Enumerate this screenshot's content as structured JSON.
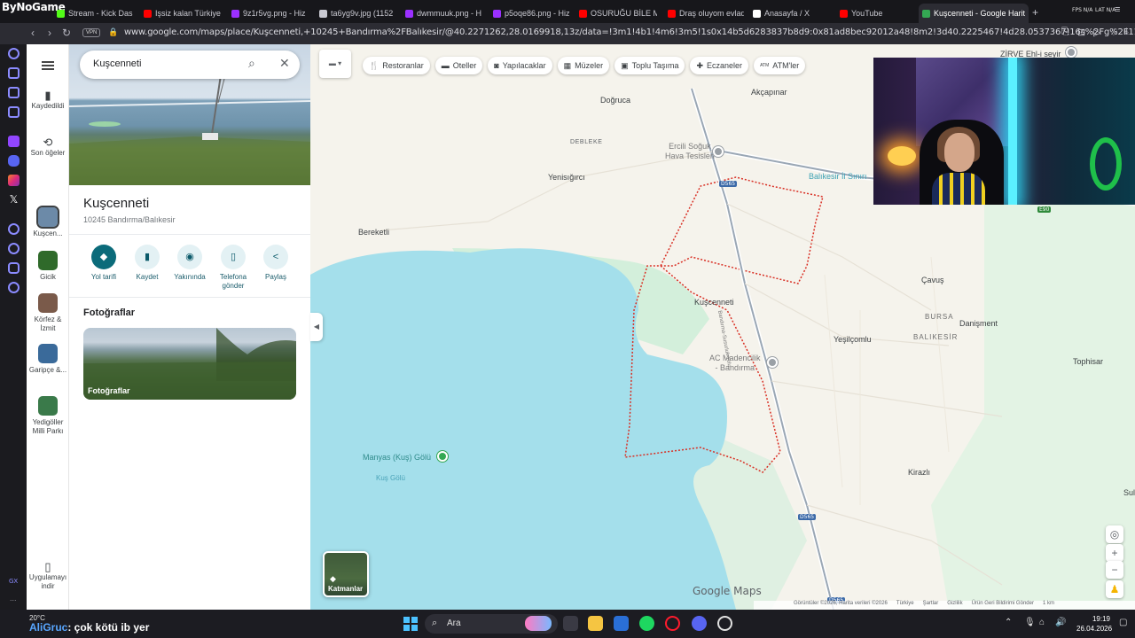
{
  "browser": {
    "logo": "ByNoGame",
    "tabs": [
      {
        "label": "Stream - Kick Das",
        "color": "#53fc18"
      },
      {
        "label": "Işsiz kalan Türkiye",
        "color": "#ff0000"
      },
      {
        "label": "9z1r5vg.png - Hiz",
        "color": "#9b30ff"
      },
      {
        "label": "ta6yg9v.jpg (1152",
        "color": "#c9c9d1"
      },
      {
        "label": "dwmmuuk.png - H",
        "color": "#9b30ff"
      },
      {
        "label": "p5oqe86.png - Hiz",
        "color": "#9b30ff"
      },
      {
        "label": "OSURUĞU BİLE M",
        "color": "#ff0000"
      },
      {
        "label": "Draş oluyom evlad",
        "color": "#ff0000"
      },
      {
        "label": "Anasayfa / X",
        "color": "#ffffff"
      },
      {
        "label": "YouTube",
        "color": "#ff0000"
      },
      {
        "label": "Kuşcenneti - Google Harit",
        "color": "#34a853"
      }
    ],
    "new_tab": "+",
    "fps": "FPS N/A",
    "lat": "LAT N/A",
    "vpn": "VPN",
    "url": "www.google.com/maps/place/Kuşcenneti,+10245+Bandırma%2FBalıkesir/@40.2271262,28.0169918,13z/data=!3m1!4b1!4m6!3m5!1s0x14b5d6283837b8d9:0x81ad8bec92012a48!8m2!3d40.2225467!4d28.0537367!16s%2Fg%2F113drxp67"
  },
  "opera_sidebar": {
    "gx": "GX",
    "more": "...",
    "icons": [
      "aria-icon",
      "maps-icon",
      "x-icon",
      "twitch-icon",
      "discord-icon",
      "instagram-icon",
      "settings-icon"
    ]
  },
  "rail": {
    "saved": "Kaydedildi",
    "recent": "Son öğeler",
    "recents": [
      {
        "label": "Kuşcen...",
        "color": "#6c8aa8"
      },
      {
        "label": "Gicik",
        "color": "#2f6a2a"
      },
      {
        "label": "Körfez & İzmit",
        "color": "#7a5a4a"
      },
      {
        "label": "Garipçe &...",
        "color": "#3a6a9a"
      },
      {
        "label": "Yedigöller Milli Parkı",
        "color": "#3a7a4a"
      }
    ],
    "get_app": "Uygulamayı indir"
  },
  "panel": {
    "search_value": "Kuşcenneti",
    "place_title": "Kuşcenneti",
    "place_address": "10245 Bandırma/Balıkesir",
    "actions": [
      {
        "label": "Yol tarifi",
        "glyph": "◆"
      },
      {
        "label": "Kaydet",
        "glyph": "▮"
      },
      {
        "label": "Yakınında",
        "glyph": "◉"
      },
      {
        "label": "Telefona gönder",
        "glyph": "▯"
      },
      {
        "label": "Paylaş",
        "glyph": "<"
      }
    ],
    "photos_title": "Fotoğraflar",
    "photos_label": "Fotoğraflar"
  },
  "map": {
    "chips": [
      {
        "label": "Restoranlar",
        "glyph": "🍴"
      },
      {
        "label": "Oteller",
        "glyph": "▬"
      },
      {
        "label": "Yapılacaklar",
        "glyph": "◙"
      },
      {
        "label": "Müzeler",
        "glyph": "▦"
      },
      {
        "label": "Toplu Taşıma",
        "glyph": "▣"
      },
      {
        "label": "Eczaneler",
        "glyph": "✚"
      },
      {
        "label": "ATM'ler",
        "glyph": "ATM"
      }
    ],
    "labels": {
      "zirve": "ZİRVE Ehl-i seyir",
      "akcapinar": "Akçapınar",
      "dogruca": "Doğruca",
      "debleke": "DEBLEKE",
      "ercili": "Ercili Soğuk\nHava Tesisleri",
      "yenisigirci": "Yenisığırcı",
      "balikesir_siniri": "Balıkesir İl Sınırı",
      "bereketli": "Bereketli",
      "cavus": "Çavuş",
      "kuscenneti": "Kuşcenneti",
      "bursa": "BURSA",
      "balikesir": "BALIKESİR",
      "danisment": "Danişment",
      "yesilcomlu": "Yeşilçomlu",
      "ac_madencilik": "AC Madencilik\n- Bandırma",
      "tophisar": "Tophisar",
      "manyas": "Manyas (Kuş) Gölü",
      "kus_golu": "Kuş Gölü",
      "kirazli": "Kirazlı",
      "sul": "Sul",
      "road": "Bandırma-Susurluk Yolu"
    },
    "shields": [
      "D565",
      "E90",
      "D565",
      "D565"
    ],
    "layers_label": "Katmanlar",
    "brand": "Google Maps",
    "footer": [
      "Görüntüler ©2026, Harita verileri ©2026",
      "Türkiye",
      "Şartlar",
      "Gizlilik",
      "Ürün Geri Bildirimi Gönder",
      "1 km"
    ],
    "colors": {
      "water": "#a4dfeb",
      "land": "#f5f3ec",
      "green": "#d3efdb",
      "boundary": "#d93025",
      "road": "#9aa7b5"
    }
  },
  "taskbar": {
    "weather": "20°C",
    "chat_user": "AliGruc",
    "chat_text": ": çok kötü ib yer",
    "search": "Ara",
    "time": "19:19",
    "date": "26.04.2026"
  }
}
